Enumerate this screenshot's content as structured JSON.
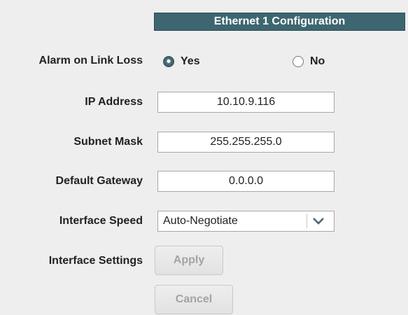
{
  "header": {
    "title": "Ethernet 1 Configuration"
  },
  "alarm": {
    "label": "Alarm on Link Loss",
    "options": [
      {
        "label": "Yes",
        "selected": true
      },
      {
        "label": "No",
        "selected": false
      }
    ]
  },
  "ip": {
    "label": "IP Address",
    "value": "10.10.9.116"
  },
  "subnet": {
    "label": "Subnet Mask",
    "value": "255.255.255.0"
  },
  "gateway": {
    "label": "Default Gateway",
    "value": "0.0.0.0"
  },
  "speed": {
    "label": "Interface Speed",
    "value": "Auto-Negotiate",
    "arrow_icon": "chevron-down-icon"
  },
  "settings": {
    "label": "Interface Settings",
    "apply_label": "Apply",
    "cancel_label": "Cancel",
    "buttons_enabled": false
  },
  "colors": {
    "header_background": "#3d6670",
    "page_background": "#eeeeee",
    "disabled_text": "#a3a3a3"
  }
}
